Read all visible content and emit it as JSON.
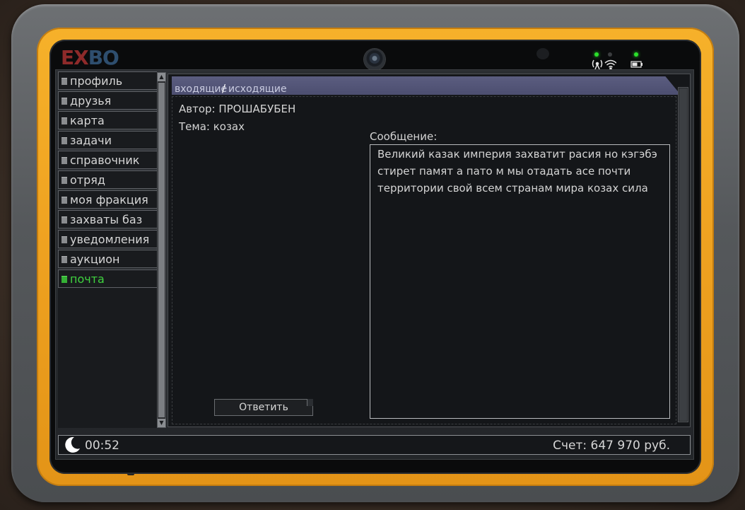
{
  "brand": {
    "logo_left": "EX",
    "logo_right": "BO"
  },
  "nav": {
    "items": [
      {
        "label": "профиль"
      },
      {
        "label": "друзья"
      },
      {
        "label": "карта"
      },
      {
        "label": "задачи"
      },
      {
        "label": "справочник"
      },
      {
        "label": "отряд"
      },
      {
        "label": "моя фракция"
      },
      {
        "label": "захваты баз"
      },
      {
        "label": "уведомления"
      },
      {
        "label": "аукцион"
      },
      {
        "label": "почта",
        "active": true
      }
    ]
  },
  "mail": {
    "tab_incoming": "входящие",
    "tab_separator": "/",
    "tab_outgoing": "исходящие",
    "author_line": "Автор: ПРОШАБУБЕН",
    "subject_line": "Тема: козах",
    "message_label": "Сообщение:",
    "message_text": "Великий казак империя захватит расия но кэгэбэ стирет памят а пато м мы отадать асе почти территории свой всем странам мира козах сила",
    "reply_button": "Ответить"
  },
  "status_bar": {
    "time": "00:52",
    "balance": "Счет: 647 970 руб."
  },
  "icons": {
    "signal": "wifi-signal-icon",
    "battery": "battery-icon",
    "night": "moon-icon"
  },
  "colors": {
    "bumper": "#eea120",
    "active_nav": "#3fd33f",
    "tab_header": "#4c4e70"
  }
}
